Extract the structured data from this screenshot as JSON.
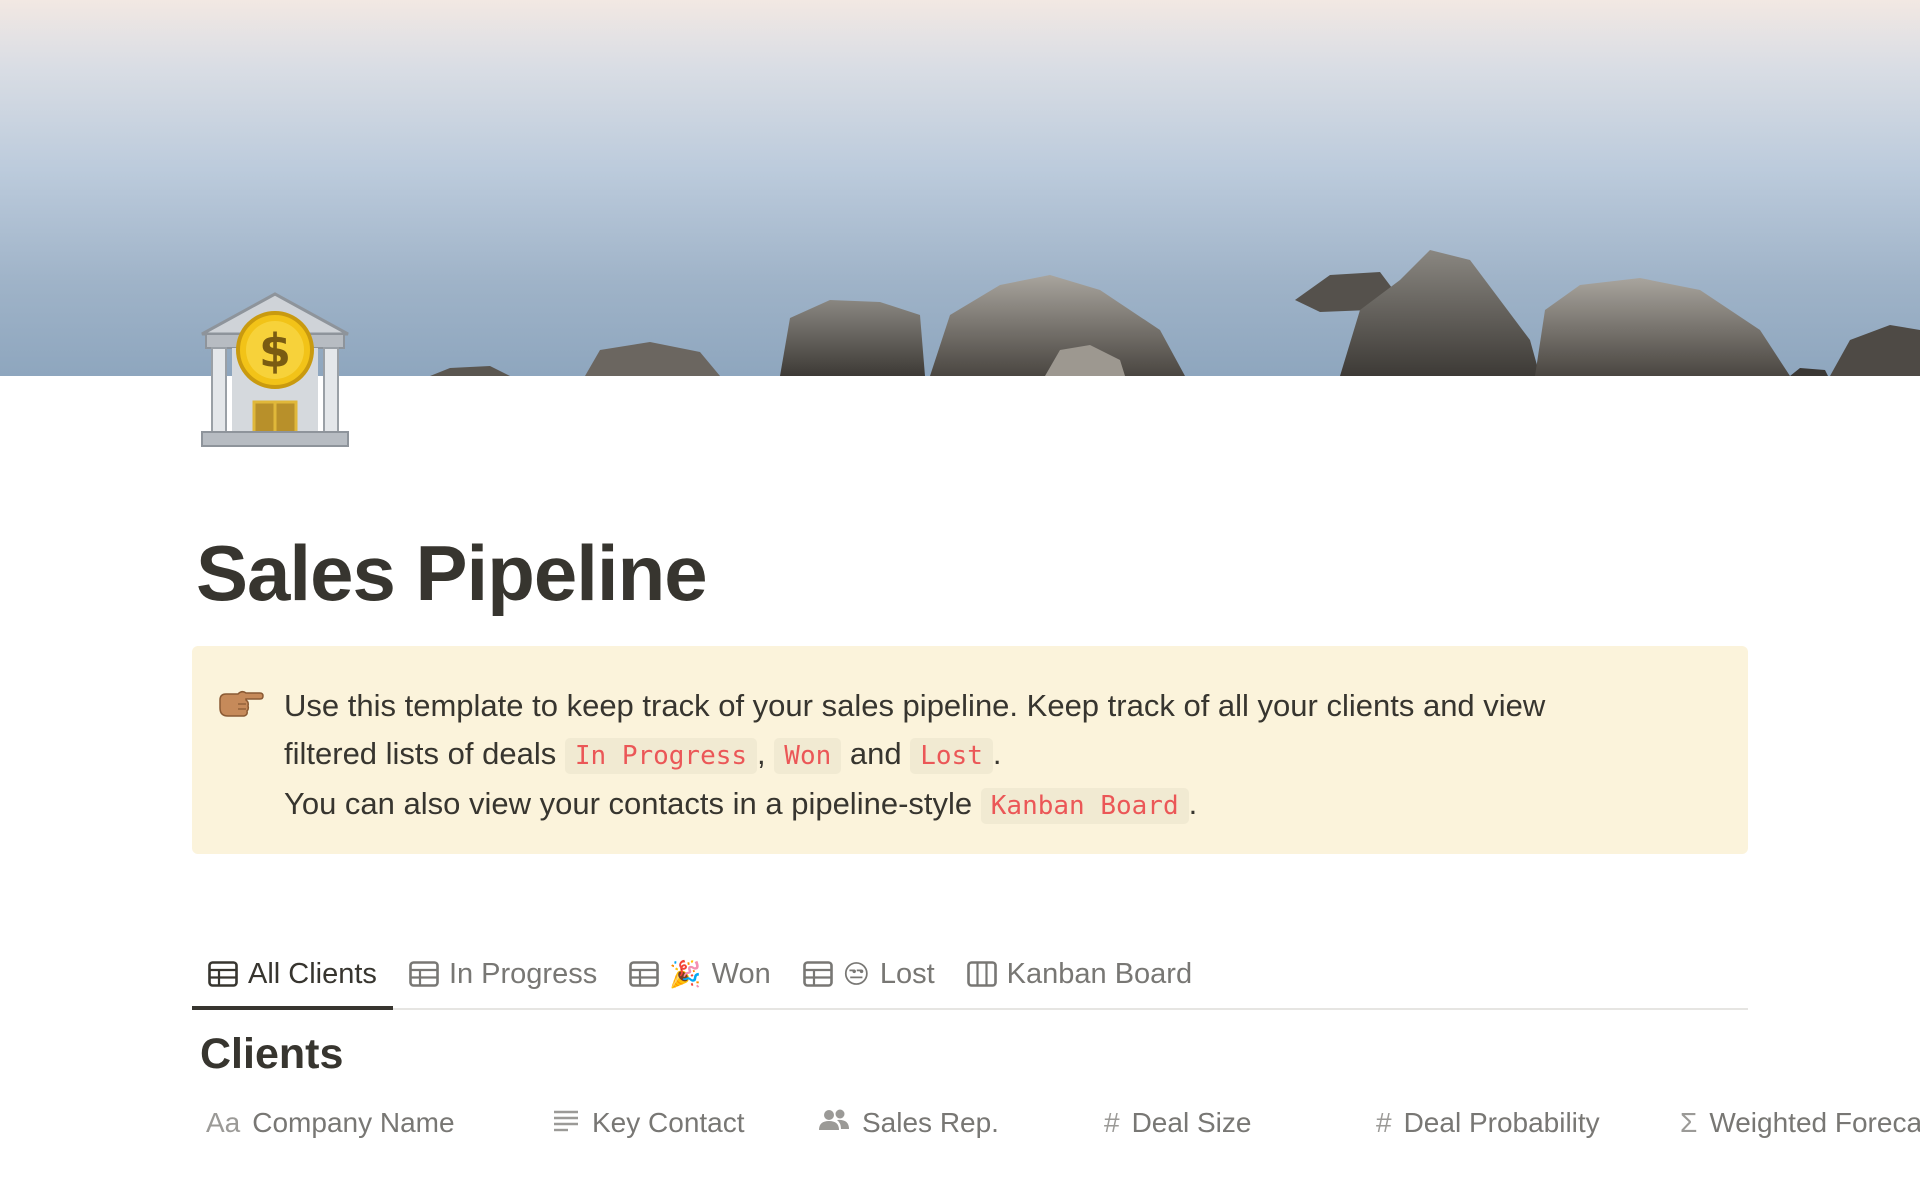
{
  "page": {
    "title": "Sales Pipeline",
    "icon": "bank-icon",
    "cover": "lake-rocks-cover-image"
  },
  "callout": {
    "icon": "pointing-hand-icon",
    "line1": "Use this template to keep track of your sales pipeline. Keep track of all your clients and view",
    "line2_prefix": "filtered lists of deals",
    "code_in_progress": "In Progress",
    "sep_comma": ",",
    "code_won": "Won",
    "sep_and": "and",
    "code_lost": "Lost",
    "period1": ".",
    "line3_prefix": "You can also view your contacts in a pipeline-style",
    "code_kanban": "Kanban Board",
    "period2": "."
  },
  "tabs": [
    {
      "label": "All Clients",
      "icon": "table-icon",
      "active": true
    },
    {
      "label": "In Progress",
      "icon": "table-icon",
      "active": false
    },
    {
      "label": "Won",
      "icon": "table-icon",
      "emoji": "🎉",
      "active": false
    },
    {
      "label": "Lost",
      "icon": "table-icon",
      "emoji": "😒",
      "active": false
    },
    {
      "label": "Kanban Board",
      "icon": "board-icon",
      "active": false
    }
  ],
  "database": {
    "title": "Clients",
    "columns": [
      {
        "label": "Company Name",
        "icon": "title-icon",
        "glyph": "Aa"
      },
      {
        "label": "Key Contact",
        "icon": "text-icon",
        "glyph": "≡"
      },
      {
        "label": "Sales Rep.",
        "icon": "person-icon",
        "glyph": "👥"
      },
      {
        "label": "Deal Size",
        "icon": "number-icon",
        "glyph": "#"
      },
      {
        "label": "Deal Probability",
        "icon": "number-icon",
        "glyph": "#"
      },
      {
        "label": "Weighted Forecast",
        "icon": "formula-icon",
        "glyph": "Σ"
      }
    ]
  },
  "colors": {
    "text": "#37352f",
    "muted": "#787774",
    "callout_bg": "#fbf3db",
    "code_red": "#eb5757"
  }
}
